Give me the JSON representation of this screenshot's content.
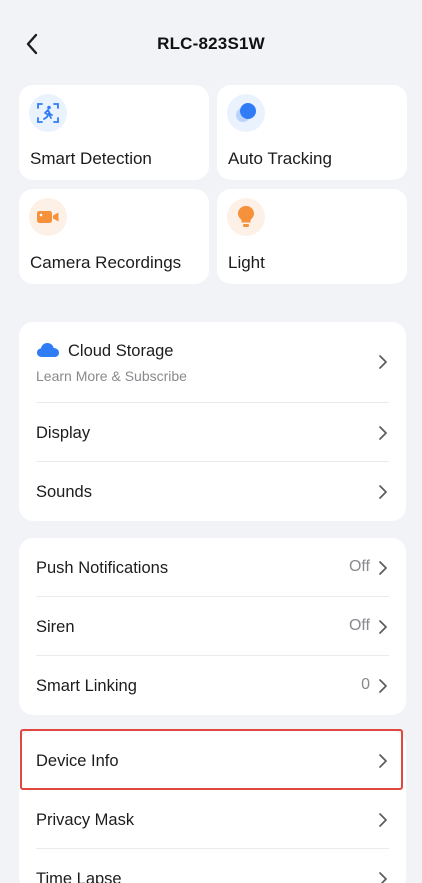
{
  "header": {
    "title": "RLC-823S1W",
    "back_icon": "chevron-left-icon"
  },
  "tiles": [
    {
      "label": "Smart Detection",
      "icon": "person-motion-icon",
      "icon_color": "#2f7cf6",
      "icon_bg": "#eaf2fe"
    },
    {
      "label": "Auto Tracking",
      "icon": "tracking-dot-icon",
      "icon_color": "#2f7cf6",
      "icon_bg": "#eaf2fe"
    },
    {
      "label": "Camera Recordings",
      "icon": "video-camera-icon",
      "icon_color": "#f5913b",
      "icon_bg": "#fdf0e6"
    },
    {
      "label": "Light",
      "icon": "light-bulb-icon",
      "icon_color": "#f5913b",
      "icon_bg": "#fdf0e6"
    }
  ],
  "group1": {
    "cloud": {
      "title": "Cloud Storage",
      "subtitle": "Learn More & Subscribe",
      "icon": "cloud-icon",
      "icon_color": "#2f7cf6"
    },
    "rows": [
      {
        "label": "Display"
      },
      {
        "label": "Sounds"
      }
    ]
  },
  "group2": {
    "rows": [
      {
        "label": "Push Notifications",
        "value": "Off"
      },
      {
        "label": "Siren",
        "value": "Off"
      },
      {
        "label": "Smart Linking",
        "value": "0"
      }
    ]
  },
  "group3": {
    "rows": [
      {
        "label": "Device Info"
      },
      {
        "label": "Privacy Mask"
      },
      {
        "label": "Time Lapse"
      }
    ]
  },
  "colors": {
    "highlight": "#e0473f",
    "background": "#f2f3f7"
  }
}
